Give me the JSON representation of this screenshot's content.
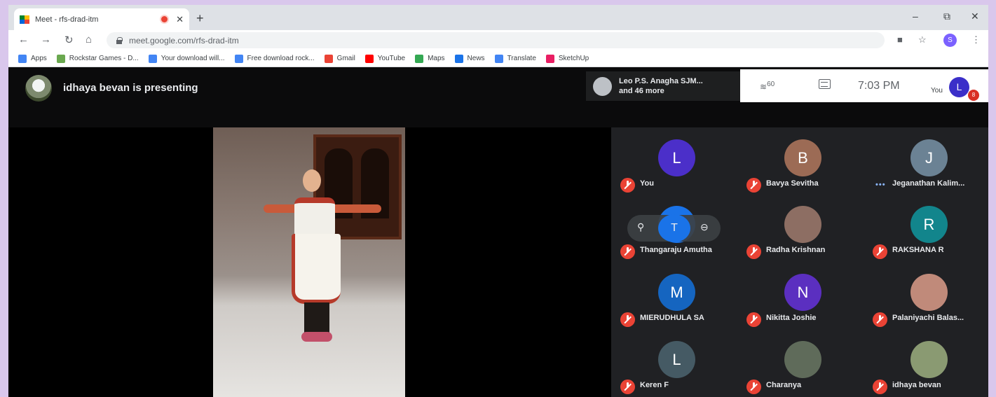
{
  "browser": {
    "tab_title": "Meet - rfs-drad-itm",
    "tab_close": "✕",
    "new_tab": "+",
    "url": "meet.google.com/rfs-drad-itm",
    "profile_initial": "S",
    "window_controls": {
      "minimize": "–",
      "restore": "⧉",
      "close": "✕"
    },
    "nav": {
      "back": "←",
      "forward": "→",
      "reload": "↻",
      "home": "⌂",
      "camera": "■",
      "star": "☆",
      "menu": "⋮"
    },
    "bookmarks": [
      {
        "label": "Apps",
        "icon": "apps-grid-icon",
        "color": "#4285f4"
      },
      {
        "label": "Rockstar Games - D...",
        "icon": "rockstar-icon",
        "color": "#6aa84f"
      },
      {
        "label": "Your download will...",
        "icon": "bookmark-icon",
        "color": "#4285f4"
      },
      {
        "label": "Free download rock...",
        "icon": "bookmark-icon",
        "color": "#4285f4"
      },
      {
        "label": "Gmail",
        "icon": "gmail-icon",
        "color": "#ea4335"
      },
      {
        "label": "YouTube",
        "icon": "youtube-icon",
        "color": "#ff0000"
      },
      {
        "label": "Maps",
        "icon": "maps-icon",
        "color": "#34a853"
      },
      {
        "label": "News",
        "icon": "news-icon",
        "color": "#1a73e8"
      },
      {
        "label": "Translate",
        "icon": "translate-icon",
        "color": "#4285f4"
      },
      {
        "label": "SketchUp",
        "icon": "sketchup-icon",
        "color": "#e91e63"
      }
    ]
  },
  "meet": {
    "presenting_text": "idhaya bevan is presenting",
    "speaker_line1": "Leo P.S. Anagha SJM...",
    "speaker_line2": "and 46 more",
    "people_count": "60",
    "clock": "7:03 PM",
    "you_label": "You",
    "my_initial": "L",
    "notification_badge": "8",
    "participants": [
      {
        "name": "You",
        "initial": "L",
        "color": "#4b2fc9",
        "status": "muted"
      },
      {
        "name": "Bavya Sevitha",
        "initial": "B",
        "color": "#9c6b55",
        "status": "muted"
      },
      {
        "name": "Jeganathan Kalim...",
        "initial": "J",
        "color": "#6b8294",
        "status": "speaking"
      },
      {
        "name": "Thangaraju Amutha",
        "initial": "",
        "color": "#1a73e8",
        "status": "muted"
      },
      {
        "name": "Radha Krishnan",
        "initial": "",
        "color": "#8d6e63",
        "status": "muted"
      },
      {
        "name": "RAKSHANA R",
        "initial": "R",
        "color": "#12858c",
        "status": "muted"
      },
      {
        "name": "MIERUDHULA SA",
        "initial": "M",
        "color": "#1565c0",
        "status": "muted"
      },
      {
        "name": "Nikitta Joshie",
        "initial": "N",
        "color": "#5b2fc0",
        "status": "muted"
      },
      {
        "name": "Palaniyachi Balas...",
        "initial": "",
        "color": "#c08a7a",
        "status": "muted"
      },
      {
        "name": "Keren F",
        "initial": "L",
        "color": "#455a64",
        "status": "muted"
      },
      {
        "name": "Charanya",
        "initial": "",
        "color": "#5f6b5a",
        "status": "muted"
      },
      {
        "name": "idhaya bevan",
        "initial": "",
        "color": "#8a9a72",
        "status": "muted"
      }
    ],
    "hover_controls": {
      "pin": "⚲",
      "mute": "T",
      "remove": "⊖"
    }
  }
}
